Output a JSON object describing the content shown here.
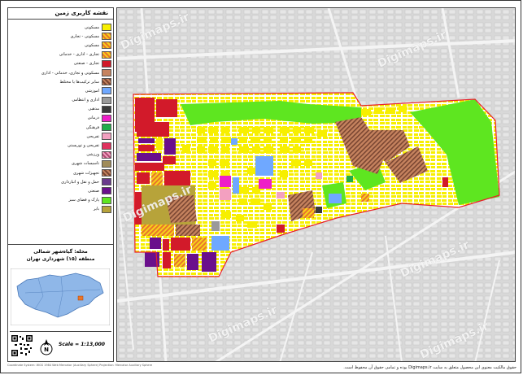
{
  "legend": {
    "title": "نقشه کاربری زمین",
    "items": [
      {
        "label": "مسکونی",
        "color": "#f7ef00",
        "pattern": "solid"
      },
      {
        "label": "مسکونی - تجاری",
        "color": "#e8762a",
        "pattern": "hatch-or"
      },
      {
        "label": "مسکونی",
        "color": "#ffb000",
        "pattern": "hatch-or"
      },
      {
        "label": "تجاری - اداری - خدماتی",
        "color": "#f7d21b",
        "pattern": "hatch-or"
      },
      {
        "label": "تجاری - صنعتی",
        "color": "#d21a2a",
        "pattern": "solid"
      },
      {
        "label": "مسکونی و تجاری، خدماتی - اداری",
        "color": "#c6835f",
        "pattern": "solid"
      },
      {
        "label": "سایر ترکیب‌ها یا مختلط",
        "color": "#8b5a3c",
        "pattern": "hatch-br"
      },
      {
        "label": "آموزشی",
        "color": "#6fa8ff",
        "pattern": "solid"
      },
      {
        "label": "اداری و انتظامی",
        "color": "#9a9a9a",
        "pattern": "solid"
      },
      {
        "label": "مذهبی",
        "color": "#3a3a3a",
        "pattern": "solid"
      },
      {
        "label": "درمانی",
        "color": "#ee1ec8",
        "pattern": "solid"
      },
      {
        "label": "فرهنگی",
        "color": "#1fae4a",
        "pattern": "solid"
      },
      {
        "label": "تفریحی",
        "color": "#f3a0c0",
        "pattern": "solid"
      },
      {
        "label": "تفریحی و توریستی",
        "color": "#e0315e",
        "pattern": "solid"
      },
      {
        "label": "ورزشی",
        "color": "#f0a0d0",
        "pattern": "hatch-pk"
      },
      {
        "label": "تاسیسات شهری",
        "color": "#a08c5a",
        "pattern": "solid"
      },
      {
        "label": "تجهیزات شهری",
        "color": "#b24a2a",
        "pattern": "hatch-br"
      },
      {
        "label": "حمل و نقل و انبارداری",
        "color": "#6a3a8c",
        "pattern": "solid"
      },
      {
        "label": "صنعتی",
        "color": "#6a0f8c",
        "pattern": "solid"
      },
      {
        "label": "پارک و فضای سبز",
        "color": "#5ee620",
        "pattern": "solid"
      },
      {
        "label": "بایر",
        "color": "#b7a33a",
        "pattern": "solid"
      }
    ]
  },
  "locality": {
    "name": "محله: گیاه‌شهر شمالی",
    "district": "منطقه (۱۵) شهرداری تهران"
  },
  "scale": "Scale = 1:13,000",
  "north_label": "N",
  "coord_note": "Coordinate System: WGS 1984 Web Mercator (Auxiliary Sphere)  Projection: Mercator Auxiliary Sphere",
  "footer": "حقوق مالکیت معنوی این محصول متعلق به سایت Digimaps.ir بوده و تمامی حقوق آن محفوظ است.",
  "watermark": "Digimaps.ir",
  "colors": {
    "park": "#5ee620",
    "residential": "#f7ef00",
    "commercial": "#d21a2a",
    "boundary": "#e8202a"
  }
}
